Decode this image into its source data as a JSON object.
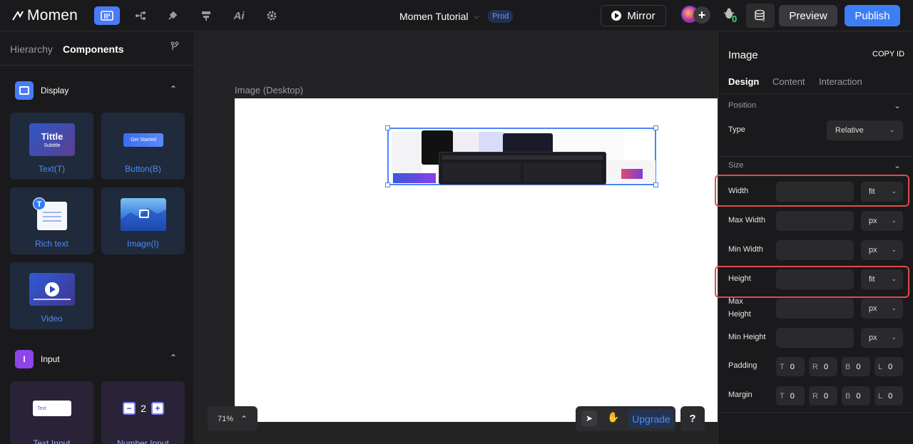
{
  "app": {
    "logo_text": "Momen",
    "project_name": "Momen Tutorial",
    "env_badge": "Prod",
    "mirror_label": "Mirror",
    "issues_count": "0",
    "preview_label": "Preview",
    "publish_label": "Publish",
    "accent_color": "#3d7ef6"
  },
  "left_panel": {
    "tabs": [
      "Hierarchy",
      "Components"
    ],
    "active_tab": "Components",
    "display_section": {
      "label": "Display",
      "items": [
        {
          "label": "Text(T)",
          "thumb_title": "Tittle",
          "thumb_subtitle": "Subtitle"
        },
        {
          "label": "Button(B)",
          "thumb_button": "Get Started"
        },
        {
          "label": "Rich text",
          "thumb_badge": "T"
        },
        {
          "label": "Image(I)"
        },
        {
          "label": "Video"
        }
      ]
    },
    "input_section": {
      "label": "Input",
      "items": [
        {
          "label": "Text Input",
          "thumb_text": "Text"
        },
        {
          "label": "Number Input",
          "thumb_minus": "−",
          "thumb_value": "2",
          "thumb_plus": "+"
        }
      ]
    }
  },
  "canvas": {
    "frame_label": "Image (Desktop)",
    "zoom": "71%",
    "upgrade_label": "Upgrade",
    "help_label": "?"
  },
  "right_panel": {
    "title": "Image",
    "copy_id": "COPY ID",
    "tabs": [
      "Design",
      "Content",
      "Interaction"
    ],
    "active_tab": "Design",
    "position": {
      "title": "Position",
      "type_label": "Type",
      "type_value": "Relative"
    },
    "size": {
      "title": "Size",
      "width_label": "Width",
      "width_unit": "fit",
      "max_width_label": "Max Width",
      "max_width_unit": "px",
      "min_width_label": "Min Width",
      "min_width_unit": "px",
      "height_label": "Height",
      "height_unit": "fit",
      "max_height_label_1": "Max",
      "max_height_label_2": "Height",
      "max_height_unit": "px",
      "min_height_label": "Min Height",
      "min_height_unit": "px",
      "padding_label": "Padding",
      "padding": {
        "T": "0",
        "R": "0",
        "B": "0",
        "L": "0"
      },
      "margin_label": "Margin",
      "margin": {
        "T": "0",
        "R": "0",
        "B": "0",
        "L": "0"
      }
    }
  }
}
